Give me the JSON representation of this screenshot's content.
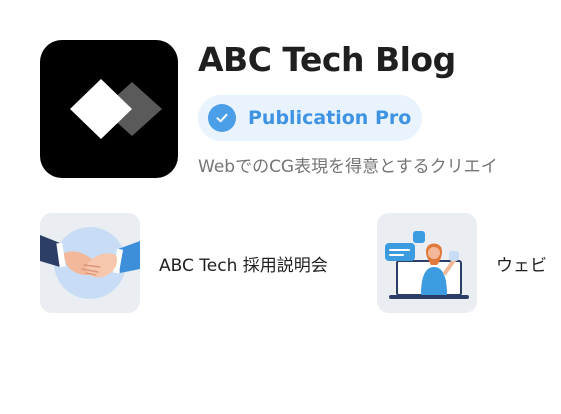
{
  "blog": {
    "title": "ABC Tech Blog",
    "badge_label": "Publication Pro",
    "description": "WebでのCG表現を得意とするクリエイ"
  },
  "cards": [
    {
      "label": "ABC Tech 採用説明会",
      "icon": "handshake-illustration"
    },
    {
      "label": "ウェビ",
      "icon": "webinar-presenter-illustration"
    }
  ],
  "colors": {
    "badge_background": "#e9f3fd",
    "badge_accent": "#4a9fe8",
    "logo_background": "#000000",
    "card_background": "#eaeef3"
  }
}
